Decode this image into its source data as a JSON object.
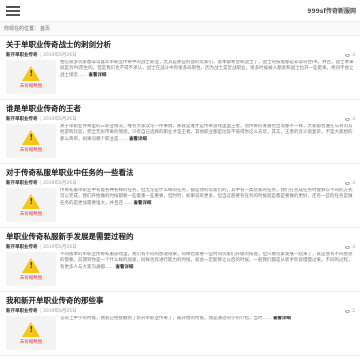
{
  "header": {
    "site_title": "999sf传奇新服网"
  },
  "breadcrumb": {
    "prefix": "你现在的位置：",
    "home": "首页"
  },
  "thumb_label": "未有缩略图",
  "more_label": "查看详细",
  "articles": [
    {
      "title": "关于单职业传奇战士的刺剑分析",
      "category": "新开单职业传奇",
      "date": "2019年6月26日",
      "views": "3",
      "summary": "相信很多玩家都非常喜欢单职业传奇中的战士职业，尤其是那些好战的玩家们，基本都希望练战士了，战士的技能都是非常符合PK，并且，战士本来就是为PK而生的。但是我们也不得不承认，战士在战斗中有很多局限性，因为战士是近战职业，很多时候被人都会和战士拉开一些距离，绝对不会让战士接近……"
    },
    {
      "title": "谁是单职业传奇的王者",
      "category": "新开单职业传奇",
      "date": "2019年6月26日",
      "views": "3",
      "summary": "关于单职业传奇里的三职业情况，唯有大家议论一件事情，那就是谁才是传奇游戏里面王者，而传奇的发展也出现都不一样，大家都普遍在与有的其他游戏比较，完全无形传奇的情感，只有自己选择的职业才是王者，其他职业都是垃圾不值得你这么去玩，其实，王者的含义很复杂，不是大家想的那么简单，如果问哪个职业是……"
    },
    {
      "title": "对于传奇私服单职业中任务的一些看法",
      "category": "新开单职业传奇",
      "date": "2019年6月26日",
      "views": "3",
      "summary": "传奇私服单职业中有着各种各样的任务，但无论是什么样的任务，都是你的玩家们的，其中有一类玩家的任务，我们在完成任务时能够以不同的方式可以完成，我们开始做的时候都要一些着重一些重要，但时时，如果说有更多，但当这部要有任务的时候就是都是要做的更好，还有一些的任务是做任务的是更加需要强大，并且还……"
    },
    {
      "title": "单职业传奇私服新手发展是需要过程的",
      "category": "新开单职业传奇",
      "date": "2019年6月26日",
      "views": "3",
      "summary": "不同版本的单职业传奇私服游戏里，我们有不同的加速效果，同样也需要一些时间玩家们升级的技能，但只要玩家发展一起来了，就是会有不同感受的需要。前期到你是一个什么样的加速，同样也有进行能力的时候，就会一定能够让以后的时候，一般我们都是从新手阶段慢慢过来，不同的过程，有更多人与大家沟通都……"
    },
    {
      "title": "我和新开单职业传奇的那些事",
      "category": "新开单职业传奇",
      "date": "2019年6月25日",
      "views": "2",
      "summary": "记得上中学的时候，我就已经接触到了新开单职业传奇了，最开始的时候，我是通过同学的介绍，当时……"
    }
  ]
}
